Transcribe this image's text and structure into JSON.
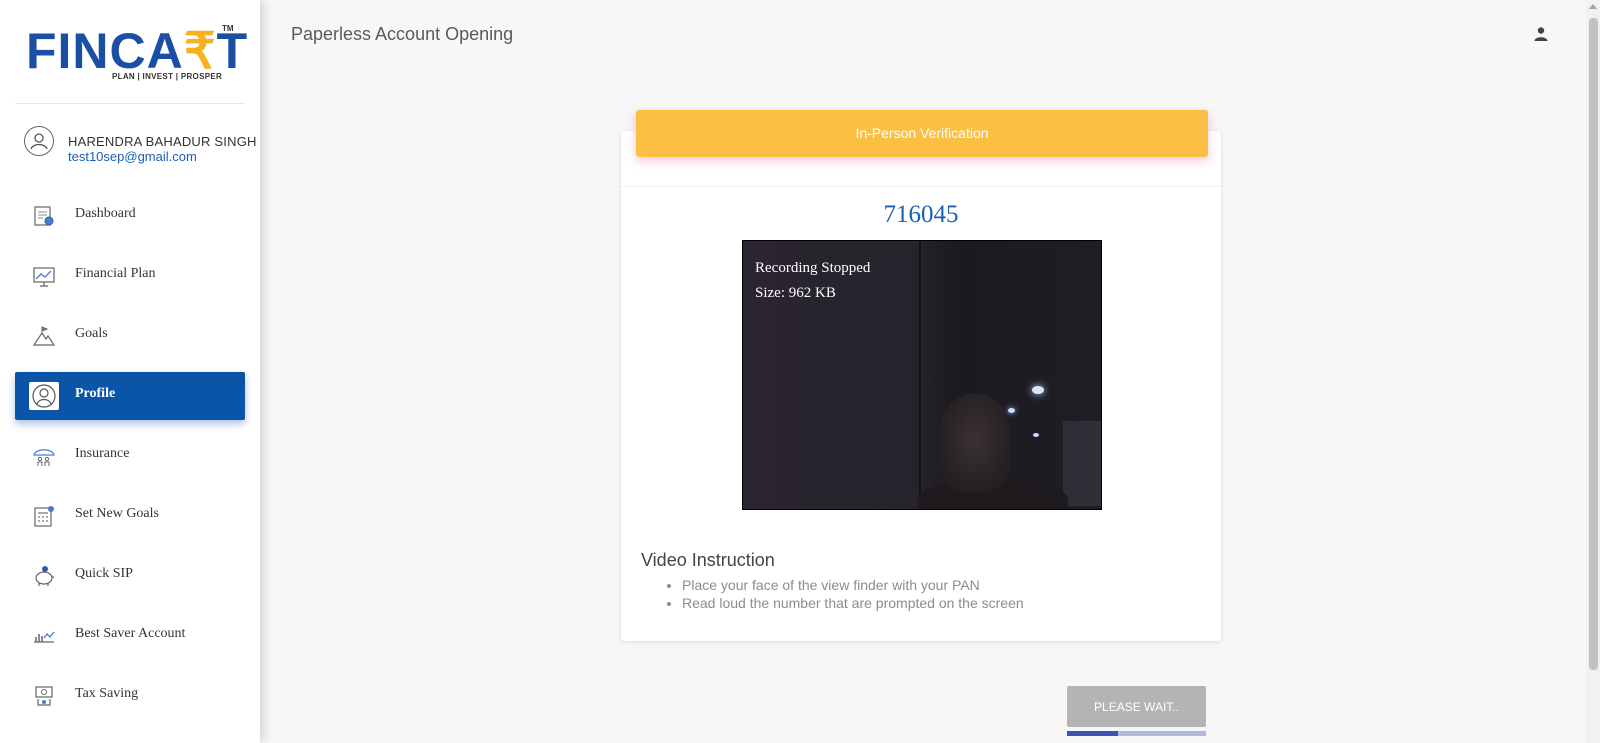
{
  "brand": {
    "name_left": "FINCA",
    "name_rupee": "₹",
    "name_right": "T",
    "tagline": "PLAN | INVEST | PROSPER",
    "tm": "TM",
    "primary_color": "#0b55a8",
    "accent_color": "#fbbf44"
  },
  "user": {
    "name": "HARENDRA BAHADUR SINGH",
    "email": "test10sep@gmail.com"
  },
  "sidebar": {
    "items": [
      {
        "label": "Dashboard",
        "icon": "dashboard-icon",
        "active": false
      },
      {
        "label": "Financial Plan",
        "icon": "chart-board-icon",
        "active": false
      },
      {
        "label": "Goals",
        "icon": "mountain-flag-icon",
        "active": false
      },
      {
        "label": "Profile",
        "icon": "user-circle-icon",
        "active": true
      },
      {
        "label": "Insurance",
        "icon": "umbrella-family-icon",
        "active": false
      },
      {
        "label": "Set New Goals",
        "icon": "calculator-icon",
        "active": false
      },
      {
        "label": "Quick SIP",
        "icon": "piggy-bank-icon",
        "active": false
      },
      {
        "label": "Best Saver Account",
        "icon": "savings-chart-icon",
        "active": false
      },
      {
        "label": "Tax Saving",
        "icon": "tax-money-icon",
        "active": false
      }
    ]
  },
  "header": {
    "title": "Paperless Account Opening",
    "account_icon": "account-icon"
  },
  "verification": {
    "banner_label": "In-Person Verification",
    "code": "716045",
    "video_status": "Recording Stopped",
    "video_size": "Size: 962 KB"
  },
  "instructions": {
    "title": "Video Instruction",
    "items": [
      "Place your face of the view finder with your PAN",
      "Read loud the number that are prompted on the screen"
    ]
  },
  "action": {
    "button_label": "PLEASE WAIT..",
    "progress": 0.37
  }
}
